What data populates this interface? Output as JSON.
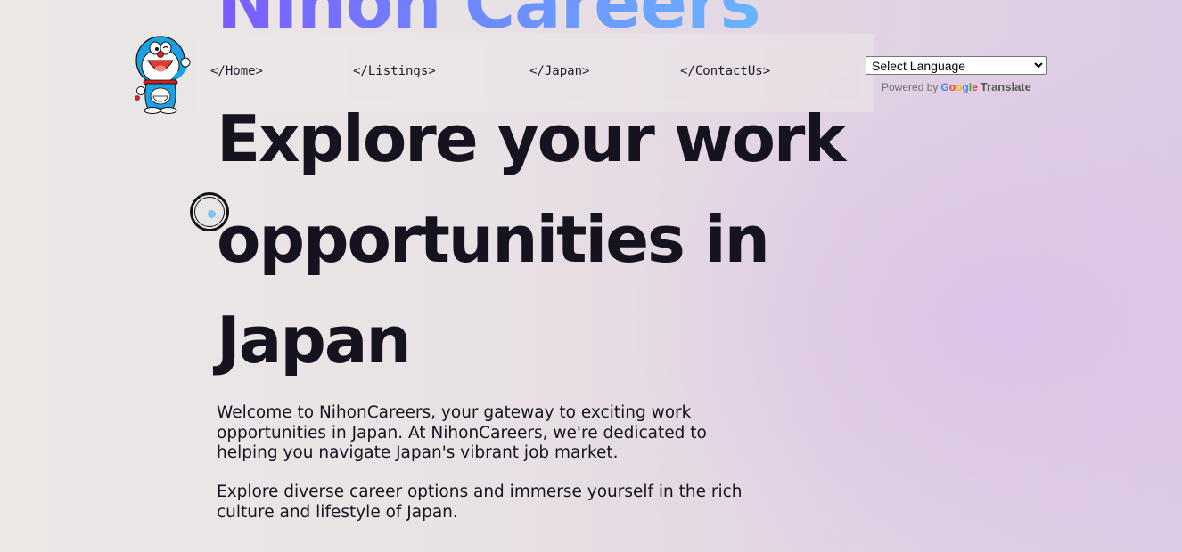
{
  "brand": {
    "title": "Nihon Careers",
    "logo_icon": "doraemon-logo-icon"
  },
  "nav": {
    "links": [
      {
        "label": "</Home>"
      },
      {
        "label": "</Listings>"
      },
      {
        "label": "</Japan>"
      },
      {
        "label": "</ContactUs>"
      }
    ]
  },
  "translate": {
    "select_value": "Select Language",
    "powered_label": "Powered by",
    "google_text": "Google",
    "translate_link": "Translate"
  },
  "hero": {
    "heading_line1": "Explore your work",
    "heading_line2": "opportunities in",
    "heading_line3": "Japan",
    "paragraph1": "Welcome to NihonCareers, your gateway to exciting work opportunities in Japan. At NihonCareers, we're dedicated to helping you navigate Japan's vibrant job market.",
    "paragraph2": "Explore diverse career options and immerse yourself in the rich culture and lifestyle of Japan."
  },
  "colors": {
    "text": "#15131f",
    "title_gradient_start": "#7b5cff",
    "title_gradient_end": "#69b5ff",
    "cursor_dot": "#7ec4f2",
    "bg_left": "#ece8e6",
    "bg_right": "#ddcbe5"
  }
}
